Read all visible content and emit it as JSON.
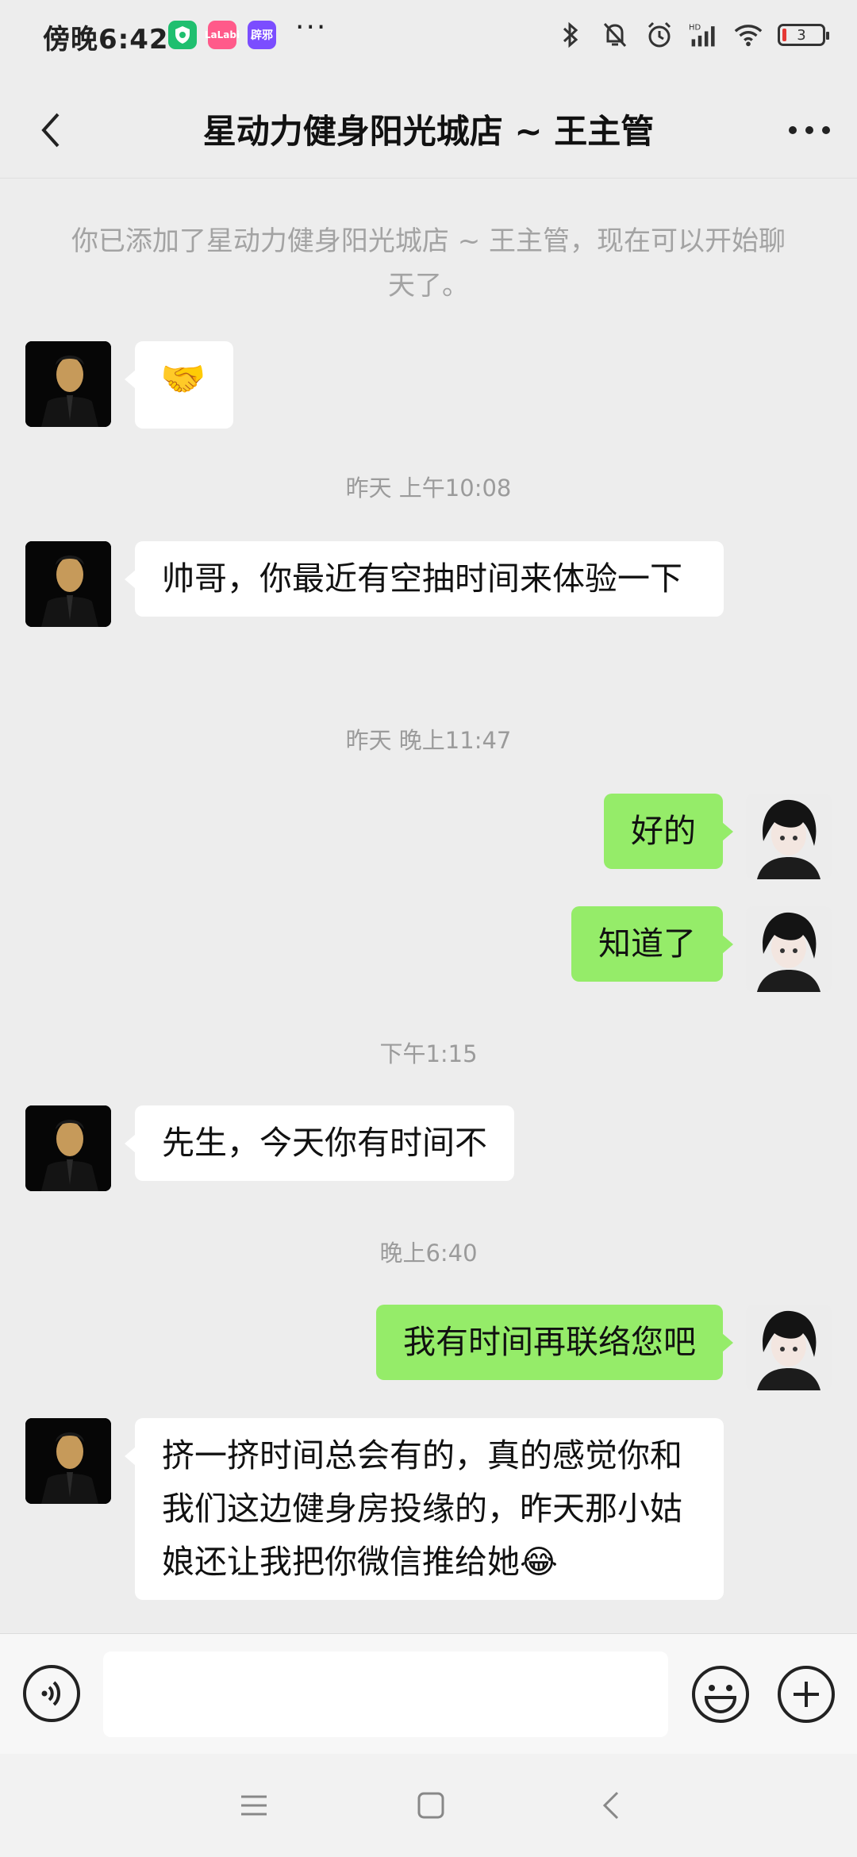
{
  "status_bar": {
    "time": "傍晚6:42",
    "apps": [
      "shield-app-icon",
      "lalabi-app-icon",
      "video-app-icon"
    ],
    "app_labels": [
      "",
      "LaLabi",
      "辟邪"
    ],
    "more": "···",
    "battery_level": "3",
    "network": "HD"
  },
  "header": {
    "title": "星动力健身阳光城店 ~ 王主管"
  },
  "chat": {
    "system_note": "你已添加了星动力健身阳光城店 ~ 王主管，现在可以开始聊天了。",
    "timestamps": [
      "昨天 上午10:08",
      "昨天 晚上11:47",
      "下午1:15",
      "晚上6:40"
    ],
    "messages": [
      {
        "side": "left",
        "text": "🤝"
      },
      {
        "side": "left",
        "text": "帅哥，你最近有空抽时间来体验一下"
      },
      {
        "side": "right",
        "text": "好的"
      },
      {
        "side": "right",
        "text": "知道了"
      },
      {
        "side": "left",
        "text": "先生，今天你有时间不"
      },
      {
        "side": "right",
        "text": "我有时间再联络您吧"
      },
      {
        "side": "left",
        "text": "挤一挤时间总会有的，真的感觉你和我们这边健身房投缘的，昨天那小姑娘还让我把你微信推给她😂"
      }
    ]
  },
  "input": {
    "value": "",
    "placeholder": ""
  },
  "colors": {
    "background": "#ededed",
    "bubble_self": "#95ec69",
    "bubble_other": "#ffffff",
    "system_text": "#a3a3a3"
  }
}
